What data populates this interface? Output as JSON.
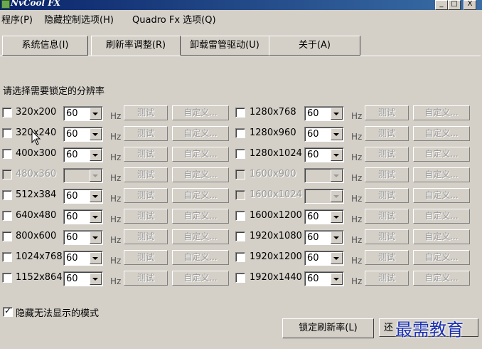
{
  "window": {
    "title": "NvCool FX",
    "minimize": "_",
    "maximize": "□",
    "close": "X"
  },
  "menu": [
    "程序(P)",
    "隐藏控制选项(H)",
    "Quadro Fx 选项(Q)"
  ],
  "tabs": [
    {
      "label": "系统信息(I)",
      "active": false
    },
    {
      "label": "刷新率调整(R)",
      "active": true
    },
    {
      "label": "卸载雷管驱动(U)",
      "active": false
    },
    {
      "label": "关于(A)",
      "active": false
    }
  ],
  "section_title": "请选择需要锁定的分辨率",
  "hz_label": "Hz",
  "test_label": "测试",
  "custom_label": "自定义...",
  "left_resolutions": [
    {
      "res": "320x200",
      "rate": "60",
      "enabled": true
    },
    {
      "res": "320x240",
      "rate": "60",
      "enabled": true
    },
    {
      "res": "400x300",
      "rate": "60",
      "enabled": true
    },
    {
      "res": "480x360",
      "rate": "",
      "enabled": false
    },
    {
      "res": "512x384",
      "rate": "60",
      "enabled": true
    },
    {
      "res": "640x480",
      "rate": "60",
      "enabled": true
    },
    {
      "res": "800x600",
      "rate": "60",
      "enabled": true
    },
    {
      "res": "1024x768",
      "rate": "60",
      "enabled": true
    },
    {
      "res": "1152x864",
      "rate": "60",
      "enabled": true
    }
  ],
  "right_resolutions": [
    {
      "res": "1280x768",
      "rate": "60",
      "enabled": true
    },
    {
      "res": "1280x960",
      "rate": "60",
      "enabled": true
    },
    {
      "res": "1280x1024",
      "rate": "60",
      "enabled": true
    },
    {
      "res": "1600x900",
      "rate": "",
      "enabled": false
    },
    {
      "res": "1600x1024",
      "rate": "",
      "enabled": false
    },
    {
      "res": "1600x1200",
      "rate": "60",
      "enabled": true
    },
    {
      "res": "1920x1080",
      "rate": "60",
      "enabled": true
    },
    {
      "res": "1920x1200",
      "rate": "60",
      "enabled": true
    },
    {
      "res": "1920x1440",
      "rate": "60",
      "enabled": true
    }
  ],
  "hide_unavailable": {
    "label": "隐藏无法显示的模式",
    "checked": true
  },
  "lock_button": "锁定刷新率(L)",
  "restore_button_partial": "还",
  "watermark": "最需教育"
}
